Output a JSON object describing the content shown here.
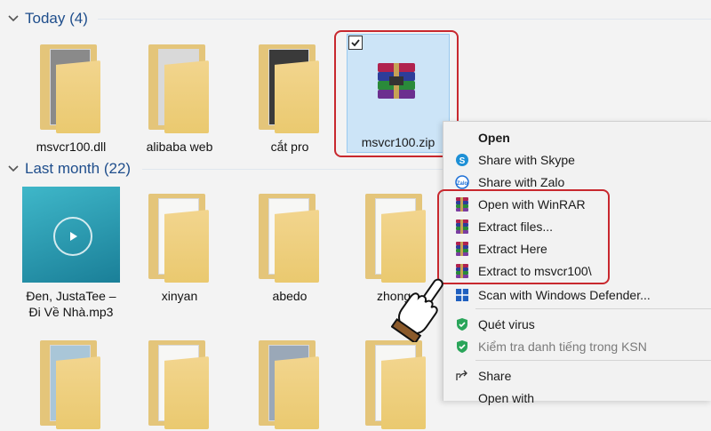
{
  "groups": {
    "today": {
      "title": "Today (4)"
    },
    "last_month": {
      "title": "Last month (22)"
    }
  },
  "today_items": [
    {
      "name": "msvcr100.dll"
    },
    {
      "name": "alibaba web"
    },
    {
      "name": "cắt pro"
    },
    {
      "name": "msvcr100.zip",
      "selected": true
    }
  ],
  "last_month_items": [
    {
      "name": "Đen, JustaTee –\nĐi Về Nhà.mp3"
    },
    {
      "name": "xinyan"
    },
    {
      "name": "abedo"
    },
    {
      "name": "zhong"
    }
  ],
  "context_menu": {
    "items": [
      {
        "label": "Open",
        "icon": "open",
        "bold": true
      },
      {
        "label": "Share with Skype",
        "icon": "skype-icon"
      },
      {
        "label": "Share with Zalo",
        "icon": "zalo-icon"
      },
      {
        "label": "Open with WinRAR",
        "icon": "winrar-icon"
      },
      {
        "label": "Extract files...",
        "icon": "winrar-icon"
      },
      {
        "label": "Extract Here",
        "icon": "winrar-icon"
      },
      {
        "label": "Extract to msvcr100\\",
        "icon": "winrar-icon"
      },
      {
        "label": "Scan with Windows Defender...",
        "icon": "defender-icon"
      },
      {
        "label": "Quét virus",
        "icon": "kaspersky-shield-icon"
      },
      {
        "label": "Kiểm tra danh tiếng trong KSN",
        "icon": "kaspersky-shield-icon",
        "disabled": true
      },
      {
        "label": "Share",
        "icon": "share-icon"
      },
      {
        "label": "Open with",
        "icon": ""
      }
    ]
  },
  "colors": {
    "group_header": "#1f4e8c",
    "selection_fill": "#cce4f7",
    "highlight_box": "#c8282e",
    "folder": "#eac96f"
  }
}
